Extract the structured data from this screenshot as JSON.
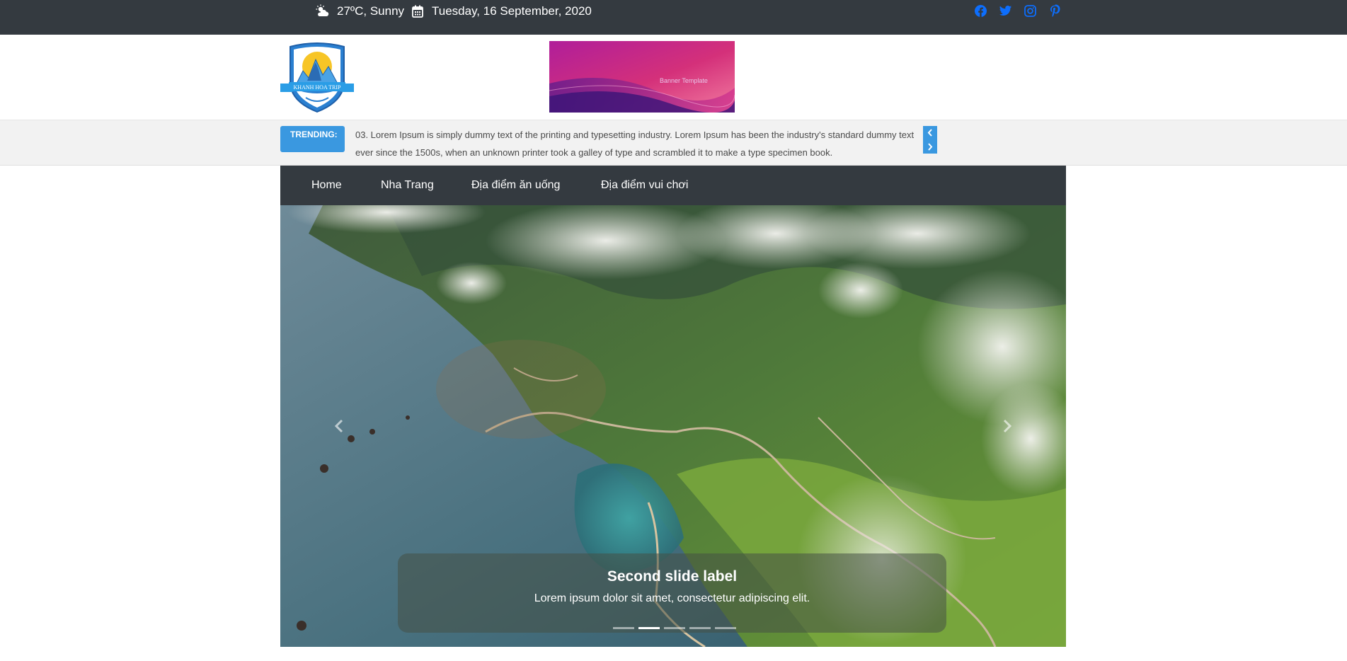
{
  "topbar": {
    "weather": "27ºC, Sunny",
    "weather_icon": "cloud-sun-icon",
    "date": "Tuesday, 16 September, 2020",
    "date_icon": "calendar-icon",
    "social": [
      "facebook-icon",
      "twitter-icon",
      "instagram-icon",
      "pinterest-icon"
    ],
    "social_color": "#0d6efd"
  },
  "header": {
    "logo_text": "KHANH HOA TRIP",
    "banner_text": "Banner Template"
  },
  "trending": {
    "label": "TRENDING:",
    "text": "03. Lorem Ipsum is simply dummy text of the printing and typesetting industry. Lorem Ipsum has been the industry's standard dummy text ever since the 1500s, when an unknown printer took a galley of type and scrambled it to make a type specimen book.",
    "accent": "#3a98e0"
  },
  "nav": {
    "items": [
      "Home",
      "Nha Trang",
      "Địa điểm ăn uống",
      "Địa điểm vui chơi"
    ]
  },
  "carousel": {
    "title": "Second slide label",
    "text": "Lorem ipsum dolor sit amet, consectetur adipiscing elit.",
    "slide_count": 5,
    "active_index": 1
  }
}
